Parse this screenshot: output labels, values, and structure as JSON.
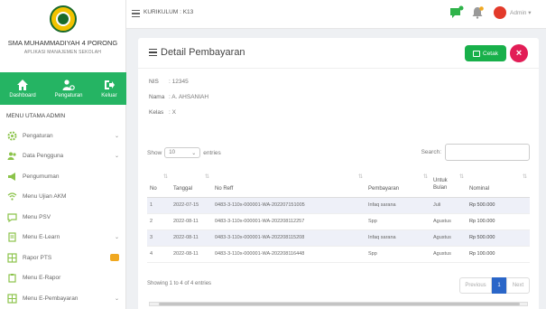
{
  "school": {
    "name": "SMA MUHAMMADIYAH 4 PORONG",
    "subtitle": "APLIKASI MANAJEMEN SEKOLAH"
  },
  "quick_links": [
    {
      "label": "Dashboard",
      "icon": "home-icon"
    },
    {
      "label": "Pengaturan",
      "icon": "users-cog-icon"
    },
    {
      "label": "Keluar",
      "icon": "logout-icon"
    }
  ],
  "menu_title": "MENU UTAMA ADMIN",
  "menu": [
    {
      "label": "Pengaturan",
      "icon": "gear-icon",
      "chevron": "⌄"
    },
    {
      "label": "Data Pengguna",
      "icon": "people-icon",
      "chevron": "⌄"
    },
    {
      "label": "Pengumuman",
      "icon": "announcement-icon"
    },
    {
      "label": "Menu Ujian AKM",
      "icon": "wifi-icon"
    },
    {
      "label": "Menu PSV",
      "icon": "chat-icon"
    },
    {
      "label": "Menu E-Learn",
      "icon": "document-icon",
      "chevron": "⌄"
    },
    {
      "label": "Rapor PTS",
      "icon": "table-icon",
      "badge": true
    },
    {
      "label": "Menu E-Rapor",
      "icon": "clipboard-icon"
    },
    {
      "label": "Menu E-Pembayaran",
      "icon": "table-icon",
      "chevron": "⌄"
    }
  ],
  "topbar": {
    "curriculum": "KURIKULUM : K13",
    "user": "Admin ▾"
  },
  "card": {
    "title": "Detail Pembayaran",
    "print_label": "Cetak",
    "close_label": "×"
  },
  "student": [
    {
      "key": "NIS",
      "value": ": 12345"
    },
    {
      "key": "Nama",
      "value": ": A. AHSANIAH"
    },
    {
      "key": "Kelas",
      "value": ": X"
    }
  ],
  "table_controls": {
    "show": "Show",
    "page_size": "10",
    "entries": "entries",
    "search": "Search:"
  },
  "table": {
    "headers": [
      "No",
      "Tanggal",
      "No Reff",
      "Pembayaran",
      "Untuk Bulan",
      "Nominal"
    ],
    "rows": [
      [
        "1",
        "2022-07-15",
        "0483-3-110x-000001-WA-202207151005",
        "Infaq sarana",
        "Juli",
        "Rp 500.000"
      ],
      [
        "2",
        "2022-08-11",
        "0483-3-110x-000001-WA-202208112257",
        "Spp",
        "Agustus",
        "Rp 100.000"
      ],
      [
        "3",
        "2022-08-11",
        "0483-3-110x-000001-WA-202208115208",
        "Infaq sarana",
        "Agustus",
        "Rp 500.000"
      ],
      [
        "4",
        "2022-08-11",
        "0483-3-110x-000001-WA-202208116448",
        "Spp",
        "Agustus",
        "Rp 100.000"
      ]
    ]
  },
  "footer": {
    "info": "Showing 1 to 4 of 4 entries",
    "prev": "Previous",
    "page": "1",
    "next": "Next"
  }
}
